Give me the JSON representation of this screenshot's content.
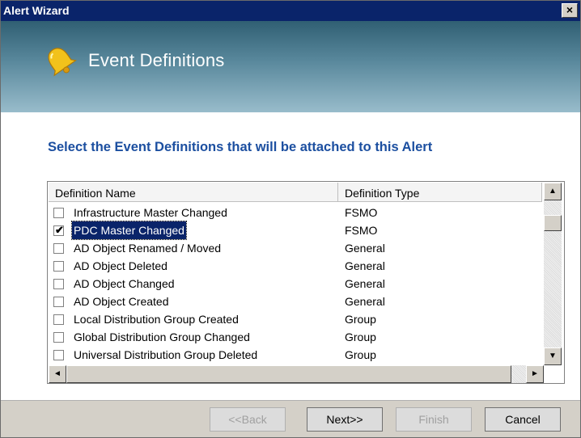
{
  "window": {
    "title": "Alert Wizard",
    "close_label": "×"
  },
  "header": {
    "title": "Event Definitions",
    "icon": "bell-icon"
  },
  "instruction": "Select the Event Definitions that will be attached to this Alert",
  "list": {
    "columns": [
      "Definition Name",
      "Definition Type"
    ],
    "rows": [
      {
        "name": "Infrastructure Master Changed",
        "type": "FSMO",
        "checked": false,
        "selected": false
      },
      {
        "name": "PDC Master Changed",
        "type": "FSMO",
        "checked": true,
        "selected": true
      },
      {
        "name": "AD Object Renamed / Moved",
        "type": "General",
        "checked": false,
        "selected": false
      },
      {
        "name": "AD Object Deleted",
        "type": "General",
        "checked": false,
        "selected": false
      },
      {
        "name": "AD Object Changed",
        "type": "General",
        "checked": false,
        "selected": false
      },
      {
        "name": "AD Object Created",
        "type": "General",
        "checked": false,
        "selected": false
      },
      {
        "name": "Local Distribution Group Created",
        "type": "Group",
        "checked": false,
        "selected": false
      },
      {
        "name": "Global Distribution Group Changed",
        "type": "Group",
        "checked": false,
        "selected": false
      },
      {
        "name": "Universal Distribution Group Deleted",
        "type": "Group",
        "checked": false,
        "selected": false
      }
    ]
  },
  "buttons": {
    "back": "<<Back",
    "next": "Next>>",
    "finish": "Finish",
    "cancel": "Cancel"
  },
  "colors": {
    "title_bar": "#0a246a",
    "instruction_text": "#1c4fa0",
    "selection": "#0a246a"
  }
}
